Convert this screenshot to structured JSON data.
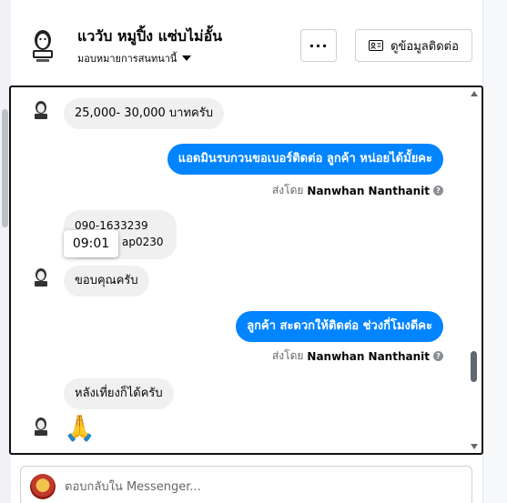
{
  "header": {
    "title": "แววับ หมูปิ้ง แซ่บไม่อั้น",
    "assign_label": "มอบหมายการสนทนานี้",
    "more_label": "···",
    "contact_button_label": "ดูข้อมูลติดต่อ"
  },
  "messages": [
    {
      "dir": "in",
      "text": "25,000- 30,000 บาทครับ"
    },
    {
      "dir": "out",
      "text": "แอดมินรบกวนขอเบอร์ติดต่อ ลูกค้า  หน่อยได้มั้ยคะ",
      "sent_by_prefix": "ส่งโดย",
      "sent_by_name": "Nanwhan Nanthanit"
    },
    {
      "dir": "in",
      "line1": "090-1633239",
      "line2": "ap0230",
      "tooltip_time": "09:01"
    },
    {
      "dir": "in",
      "text": "ขอบคุณครับ"
    },
    {
      "dir": "out",
      "text": "ลูกค้า  สะดวกให้ติดต่อ ช่วงกี่โมงดีคะ",
      "sent_by_prefix": "ส่งโดย",
      "sent_by_name": "Nanwhan Nanthanit"
    },
    {
      "dir": "in",
      "text": "หลังเที่ยงก็ได้ครับ"
    },
    {
      "dir": "in",
      "emoji": "🙏"
    }
  ],
  "composer": {
    "placeholder": "ตอบกลับใน Messenger..."
  },
  "colors": {
    "accent": "#0084ff",
    "incoming_bubble": "#f0f0f0"
  }
}
